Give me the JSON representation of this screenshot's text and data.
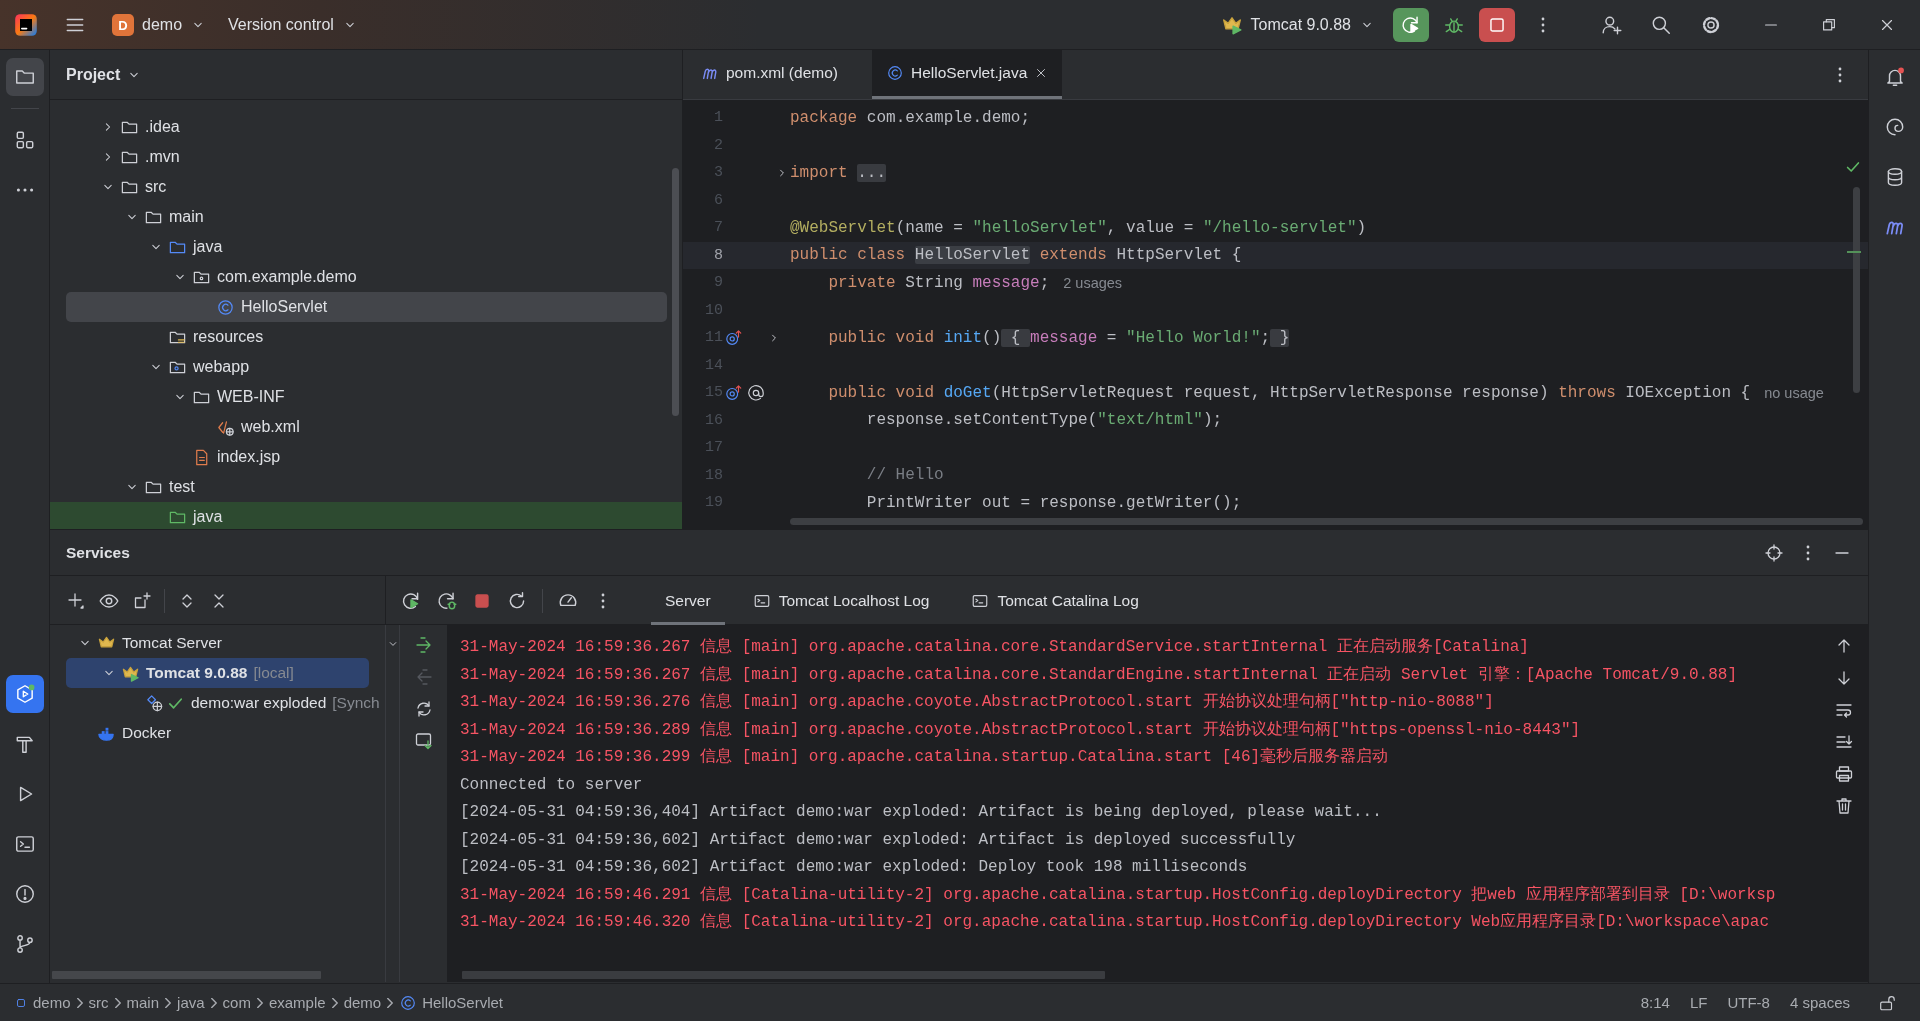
{
  "title_bar": {
    "project_badge": "D",
    "project": "demo",
    "vcs": "Version control",
    "run_configuration": "Tomcat 9.0.88"
  },
  "left_toolbar": {
    "top": [
      {
        "kind": "project",
        "selected": true,
        "focused": false
      },
      {
        "kind": "structure",
        "selected": false,
        "focused": false
      },
      {
        "kind": "more",
        "selected": false,
        "focused": false
      }
    ],
    "bottom": [
      {
        "kind": "services",
        "selected": true,
        "focused": true
      },
      {
        "kind": "build",
        "selected": false,
        "focused": false
      },
      {
        "kind": "run",
        "selected": false,
        "focused": false
      },
      {
        "kind": "terminal",
        "selected": false,
        "focused": false
      },
      {
        "kind": "problems",
        "selected": false,
        "focused": false
      },
      {
        "kind": "git",
        "selected": false,
        "focused": false
      }
    ]
  },
  "right_toolbar": [
    {
      "kind": "notifications"
    },
    {
      "kind": "ai"
    },
    {
      "kind": "database"
    },
    {
      "kind": "maven"
    }
  ],
  "project": {
    "title": "Project",
    "tree": [
      {
        "label": ".idea",
        "kind": "folder",
        "expanded": false,
        "selected": false,
        "highlighted": false
      },
      {
        "label": ".mvn",
        "kind": "folder",
        "expanded": false,
        "selected": false,
        "highlighted": false
      },
      {
        "label": "src",
        "kind": "folder",
        "expanded": true,
        "selected": false,
        "highlighted": false,
        "children": [
          {
            "label": "main",
            "kind": "folder",
            "expanded": true,
            "selected": false,
            "highlighted": false,
            "children": [
              {
                "label": "java",
                "kind": "source-folder",
                "expanded": true,
                "selected": false,
                "highlighted": false,
                "children": [
                  {
                    "label": "com.example.demo",
                    "kind": "package",
                    "expanded": true,
                    "selected": false,
                    "highlighted": false,
                    "children": [
                      {
                        "label": "HelloServlet",
                        "kind": "class",
                        "selected": true,
                        "highlighted": false
                      }
                    ]
                  }
                ]
              },
              {
                "label": "resources",
                "kind": "resources-folder",
                "selected": false,
                "highlighted": false
              },
              {
                "label": "webapp",
                "kind": "web-folder",
                "expanded": true,
                "selected": false,
                "highlighted": false,
                "children": [
                  {
                    "label": "WEB-INF",
                    "kind": "folder",
                    "expanded": true,
                    "selected": false,
                    "highlighted": false,
                    "children": [
                      {
                        "label": "web.xml",
                        "kind": "xml",
                        "selected": false,
                        "highlighted": false
                      }
                    ]
                  },
                  {
                    "label": "index.jsp",
                    "kind": "jsp",
                    "selected": false,
                    "highlighted": false
                  }
                ]
              }
            ]
          },
          {
            "label": "test",
            "kind": "folder",
            "expanded": true,
            "selected": false,
            "highlighted": false,
            "children": [
              {
                "label": "java",
                "kind": "test-folder",
                "selected": false,
                "highlighted": true
              }
            ]
          }
        ]
      }
    ]
  },
  "editor": {
    "tabs": [
      {
        "label": "pom.xml (demo)",
        "kind": "maven",
        "selected": false
      },
      {
        "label": "HelloServlet.java",
        "kind": "class",
        "selected": true
      }
    ],
    "lines": [
      {
        "number": "1",
        "current": false,
        "folded": false,
        "tokens": [
          {
            "kind": "keyword",
            "text": "package"
          },
          {
            "kind": "plain",
            "text": " com.example.demo;"
          }
        ]
      },
      {
        "number": "2",
        "current": false,
        "folded": false
      },
      {
        "number": "3",
        "current": false,
        "folded": true,
        "tokens": [
          {
            "kind": "keyword",
            "text": "import "
          },
          {
            "kind": "folded",
            "text": "..."
          }
        ]
      },
      {
        "number": "6",
        "current": false,
        "folded": false
      },
      {
        "number": "7",
        "current": false,
        "folded": false,
        "tokens": [
          {
            "kind": "annotation",
            "text": "@WebServlet"
          },
          {
            "kind": "plain",
            "text": "(name = "
          },
          {
            "kind": "string",
            "text": "\"helloServlet\""
          },
          {
            "kind": "plain",
            "text": ", value = "
          },
          {
            "kind": "string",
            "text": "\"/hello-servlet\""
          },
          {
            "kind": "plain",
            "text": ")"
          }
        ]
      },
      {
        "number": "8",
        "current": true,
        "folded": false,
        "tokens": [
          {
            "kind": "keyword",
            "text": "public class "
          },
          {
            "kind": "highlighted",
            "text": "HelloServlet"
          },
          {
            "kind": "keyword",
            "text": " extends "
          },
          {
            "kind": "plain",
            "text": "HttpServlet {"
          }
        ]
      },
      {
        "number": "9",
        "current": false,
        "folded": false,
        "tokens": [
          {
            "kind": "keyword",
            "text": "    private "
          },
          {
            "kind": "plain",
            "text": "String "
          },
          {
            "kind": "field",
            "text": "message"
          },
          {
            "kind": "plain",
            "text": ";"
          }
        ],
        "hint": "2 usages"
      },
      {
        "number": "10",
        "current": false,
        "folded": false
      },
      {
        "number": "11",
        "current": false,
        "folded": true,
        "gutter": [
          {
            "kind": "override"
          }
        ],
        "tokens": [
          {
            "kind": "keyword",
            "text": "    public void "
          },
          {
            "kind": "method",
            "text": "init"
          },
          {
            "kind": "plain",
            "text": "()"
          },
          {
            "kind": "folded",
            "text": " { "
          },
          {
            "kind": "field",
            "text": "message"
          },
          {
            "kind": "plain",
            "text": " = "
          },
          {
            "kind": "string",
            "text": "\"Hello World!\""
          },
          {
            "kind": "plain",
            "text": ";"
          },
          {
            "kind": "folded",
            "text": " }"
          }
        ]
      },
      {
        "number": "14",
        "current": false,
        "folded": false
      },
      {
        "number": "15",
        "current": false,
        "folded": false,
        "gutter": [
          {
            "kind": "override"
          },
          {
            "kind": "web"
          }
        ],
        "tokens": [
          {
            "kind": "keyword",
            "text": "    public void "
          },
          {
            "kind": "method",
            "text": "doGet"
          },
          {
            "kind": "plain",
            "text": "(HttpServletRequest request, HttpServletResponse response) "
          },
          {
            "kind": "keyword",
            "text": "throws "
          },
          {
            "kind": "plain",
            "text": "IOException {"
          }
        ],
        "hint": "no usage"
      },
      {
        "number": "16",
        "current": false,
        "folded": false,
        "tokens": [
          {
            "kind": "plain",
            "text": "        response.setContentType("
          },
          {
            "kind": "string",
            "text": "\"text/html\""
          },
          {
            "kind": "plain",
            "text": ");"
          }
        ]
      },
      {
        "number": "17",
        "current": false,
        "folded": false
      },
      {
        "number": "18",
        "current": false,
        "folded": false,
        "tokens": [
          {
            "kind": "comment",
            "text": "        // Hello"
          }
        ]
      },
      {
        "number": "19",
        "current": false,
        "folded": false,
        "tokens": [
          {
            "kind": "plain",
            "text": "        PrintWriter out = response.getWriter();"
          }
        ]
      }
    ]
  },
  "services": {
    "title": "Services",
    "tree": [
      {
        "label": "Tomcat Server",
        "kind": "server-group",
        "expanded": true,
        "selected": false,
        "children": [
          {
            "label": "Tomcat 9.0.88",
            "suffix": "[local]",
            "kind": "server",
            "expanded": true,
            "selected": true,
            "children": [
              {
                "label": "demo:war exploded",
                "suffix": "[Synch",
                "kind": "artifact",
                "selected": false
              }
            ]
          }
        ]
      },
      {
        "label": "Docker",
        "kind": "docker",
        "selected": false
      }
    ],
    "tabs": [
      {
        "label": "Server",
        "kind": "plain",
        "selected": true
      },
      {
        "label": "Tomcat Localhost Log",
        "kind": "log",
        "selected": false
      },
      {
        "label": "Tomcat Catalina Log",
        "kind": "log",
        "selected": false
      }
    ],
    "console": [
      {
        "kind": "stderr",
        "text": "31-May-2024 16:59:36.267 信息 [main] org.apache.catalina.core.StandardService.startInternal 正在启动服务[Catalina]"
      },
      {
        "kind": "stderr",
        "text": "31-May-2024 16:59:36.267 信息 [main] org.apache.catalina.core.StandardEngine.startInternal 正在启动 Servlet 引擎：[Apache Tomcat/9.0.88]"
      },
      {
        "kind": "stderr",
        "text": "31-May-2024 16:59:36.276 信息 [main] org.apache.coyote.AbstractProtocol.start 开始协议处理句柄[\"http-nio-8088\"]"
      },
      {
        "kind": "stderr",
        "text": "31-May-2024 16:59:36.289 信息 [main] org.apache.coyote.AbstractProtocol.start 开始协议处理句柄[\"https-openssl-nio-8443\"]"
      },
      {
        "kind": "stderr",
        "text": "31-May-2024 16:59:36.299 信息 [main] org.apache.catalina.startup.Catalina.start [46]毫秒后服务器启动"
      },
      {
        "kind": "stdout",
        "text": "Connected to server"
      },
      {
        "kind": "stdout",
        "text": "[2024-05-31 04:59:36,404] Artifact demo:war exploded: Artifact is being deployed, please wait..."
      },
      {
        "kind": "stdout",
        "text": "[2024-05-31 04:59:36,602] Artifact demo:war exploded: Artifact is deployed successfully"
      },
      {
        "kind": "stdout",
        "text": "[2024-05-31 04:59:36,602] Artifact demo:war exploded: Deploy took 198 milliseconds"
      },
      {
        "kind": "stderr",
        "text": "31-May-2024 16:59:46.291 信息 [Catalina-utility-2] org.apache.catalina.startup.HostConfig.deployDirectory 把web 应用程序部署到目录 [D:\\worksp"
      },
      {
        "kind": "stderr",
        "text": "31-May-2024 16:59:46.320 信息 [Catalina-utility-2] org.apache.catalina.startup.HostConfig.deployDirectory Web应用程序目录[D:\\workspace\\apac"
      }
    ]
  },
  "status_bar": {
    "breadcrumbs": [
      {
        "text": "demo",
        "kind": "module"
      },
      {
        "text": "src",
        "kind": "folder"
      },
      {
        "text": "main",
        "kind": "folder"
      },
      {
        "text": "java",
        "kind": "folder"
      },
      {
        "text": "com",
        "kind": "folder"
      },
      {
        "text": "example",
        "kind": "folder"
      },
      {
        "text": "demo",
        "kind": "folder"
      },
      {
        "text": "HelloServlet",
        "kind": "class"
      }
    ],
    "items": [
      "8:14",
      "LF",
      "UTF-8",
      "4 spaces"
    ]
  }
}
